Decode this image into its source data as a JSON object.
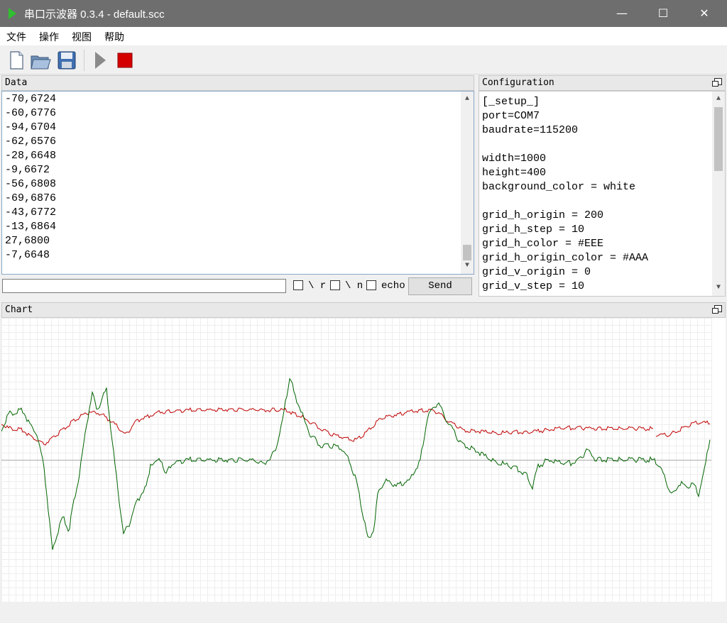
{
  "window": {
    "title": "串口示波器 0.3.4 - default.scc",
    "minimize": "—",
    "maximize": "☐",
    "close": "✕"
  },
  "menu": [
    "文件",
    "操作",
    "视图",
    "帮助"
  ],
  "toolbar": {
    "icons": [
      "new-file-icon",
      "open-folder-icon",
      "save-disk-icon",
      "play-icon",
      "stop-icon"
    ]
  },
  "data_panel": {
    "title": "Data",
    "lines": [
      "-70,6724",
      "-60,6776",
      "-94,6704",
      "-62,6576",
      "-28,6648",
      "-9,6672",
      "-56,6808",
      "-69,6876",
      "-43,6772",
      "-13,6864",
      "27,6800",
      "-7,6648"
    ]
  },
  "send_bar": {
    "input_value": "",
    "cr_label": "\\ r",
    "lf_label": "\\ n",
    "echo_label": "echo",
    "send_label": "Send"
  },
  "config_panel": {
    "title": "Configuration",
    "lines": [
      "[_setup_]",
      "port=COM7",
      "baudrate=115200",
      "",
      "width=1000",
      "height=400",
      "background_color = white",
      "",
      "grid_h_origin = 200",
      "grid_h_step = 10",
      "grid_h_color = #EEE",
      "grid_h_origin_color = #AAA",
      "grid_v_origin = 0",
      "grid_v_step = 10"
    ]
  },
  "chart_panel": {
    "title": "Chart"
  },
  "colors": {
    "accent_play": "#2fbf2f",
    "stop": "#d40000",
    "series_red": "#c00000",
    "series_green": "#006400",
    "grid": "#EEE",
    "grid_origin": "#AAA"
  }
}
